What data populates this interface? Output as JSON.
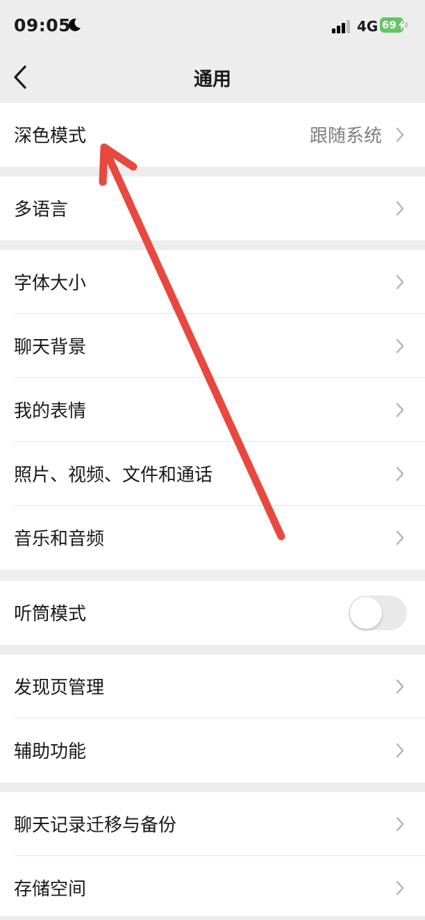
{
  "status_bar": {
    "time": "09:05",
    "network": "4G",
    "battery": "69",
    "icons": [
      "moon-icon",
      "signal-icon",
      "battery-icon",
      "charging-bolt-icon"
    ],
    "battery_color": "#65c466"
  },
  "nav": {
    "title": "通用",
    "back_icon": "chevron-left-icon"
  },
  "groups": [
    {
      "rows": [
        {
          "label": "深色模式",
          "value": "跟随系统"
        }
      ]
    },
    {
      "rows": [
        {
          "label": "多语言"
        }
      ]
    },
    {
      "rows": [
        {
          "label": "字体大小"
        },
        {
          "label": "聊天背景"
        },
        {
          "label": "我的表情"
        },
        {
          "label": "照片、视频、文件和通话"
        },
        {
          "label": "音乐和音频"
        }
      ]
    },
    {
      "rows": [
        {
          "label": "听筒模式",
          "toggle": "off"
        }
      ]
    },
    {
      "rows": [
        {
          "label": "发现页管理"
        },
        {
          "label": "辅助功能"
        }
      ]
    },
    {
      "rows": [
        {
          "label": "聊天记录迁移与备份"
        },
        {
          "label": "存储空间"
        }
      ]
    }
  ],
  "annotation": {
    "icon": "red-arrow-icon",
    "color": "#e8483f",
    "points_to": "深色模式"
  },
  "colors": {
    "background": "#ededed",
    "card": "#ffffff",
    "secondary_text": "#7f7f7f",
    "chevron": "#b2b2b2"
  }
}
